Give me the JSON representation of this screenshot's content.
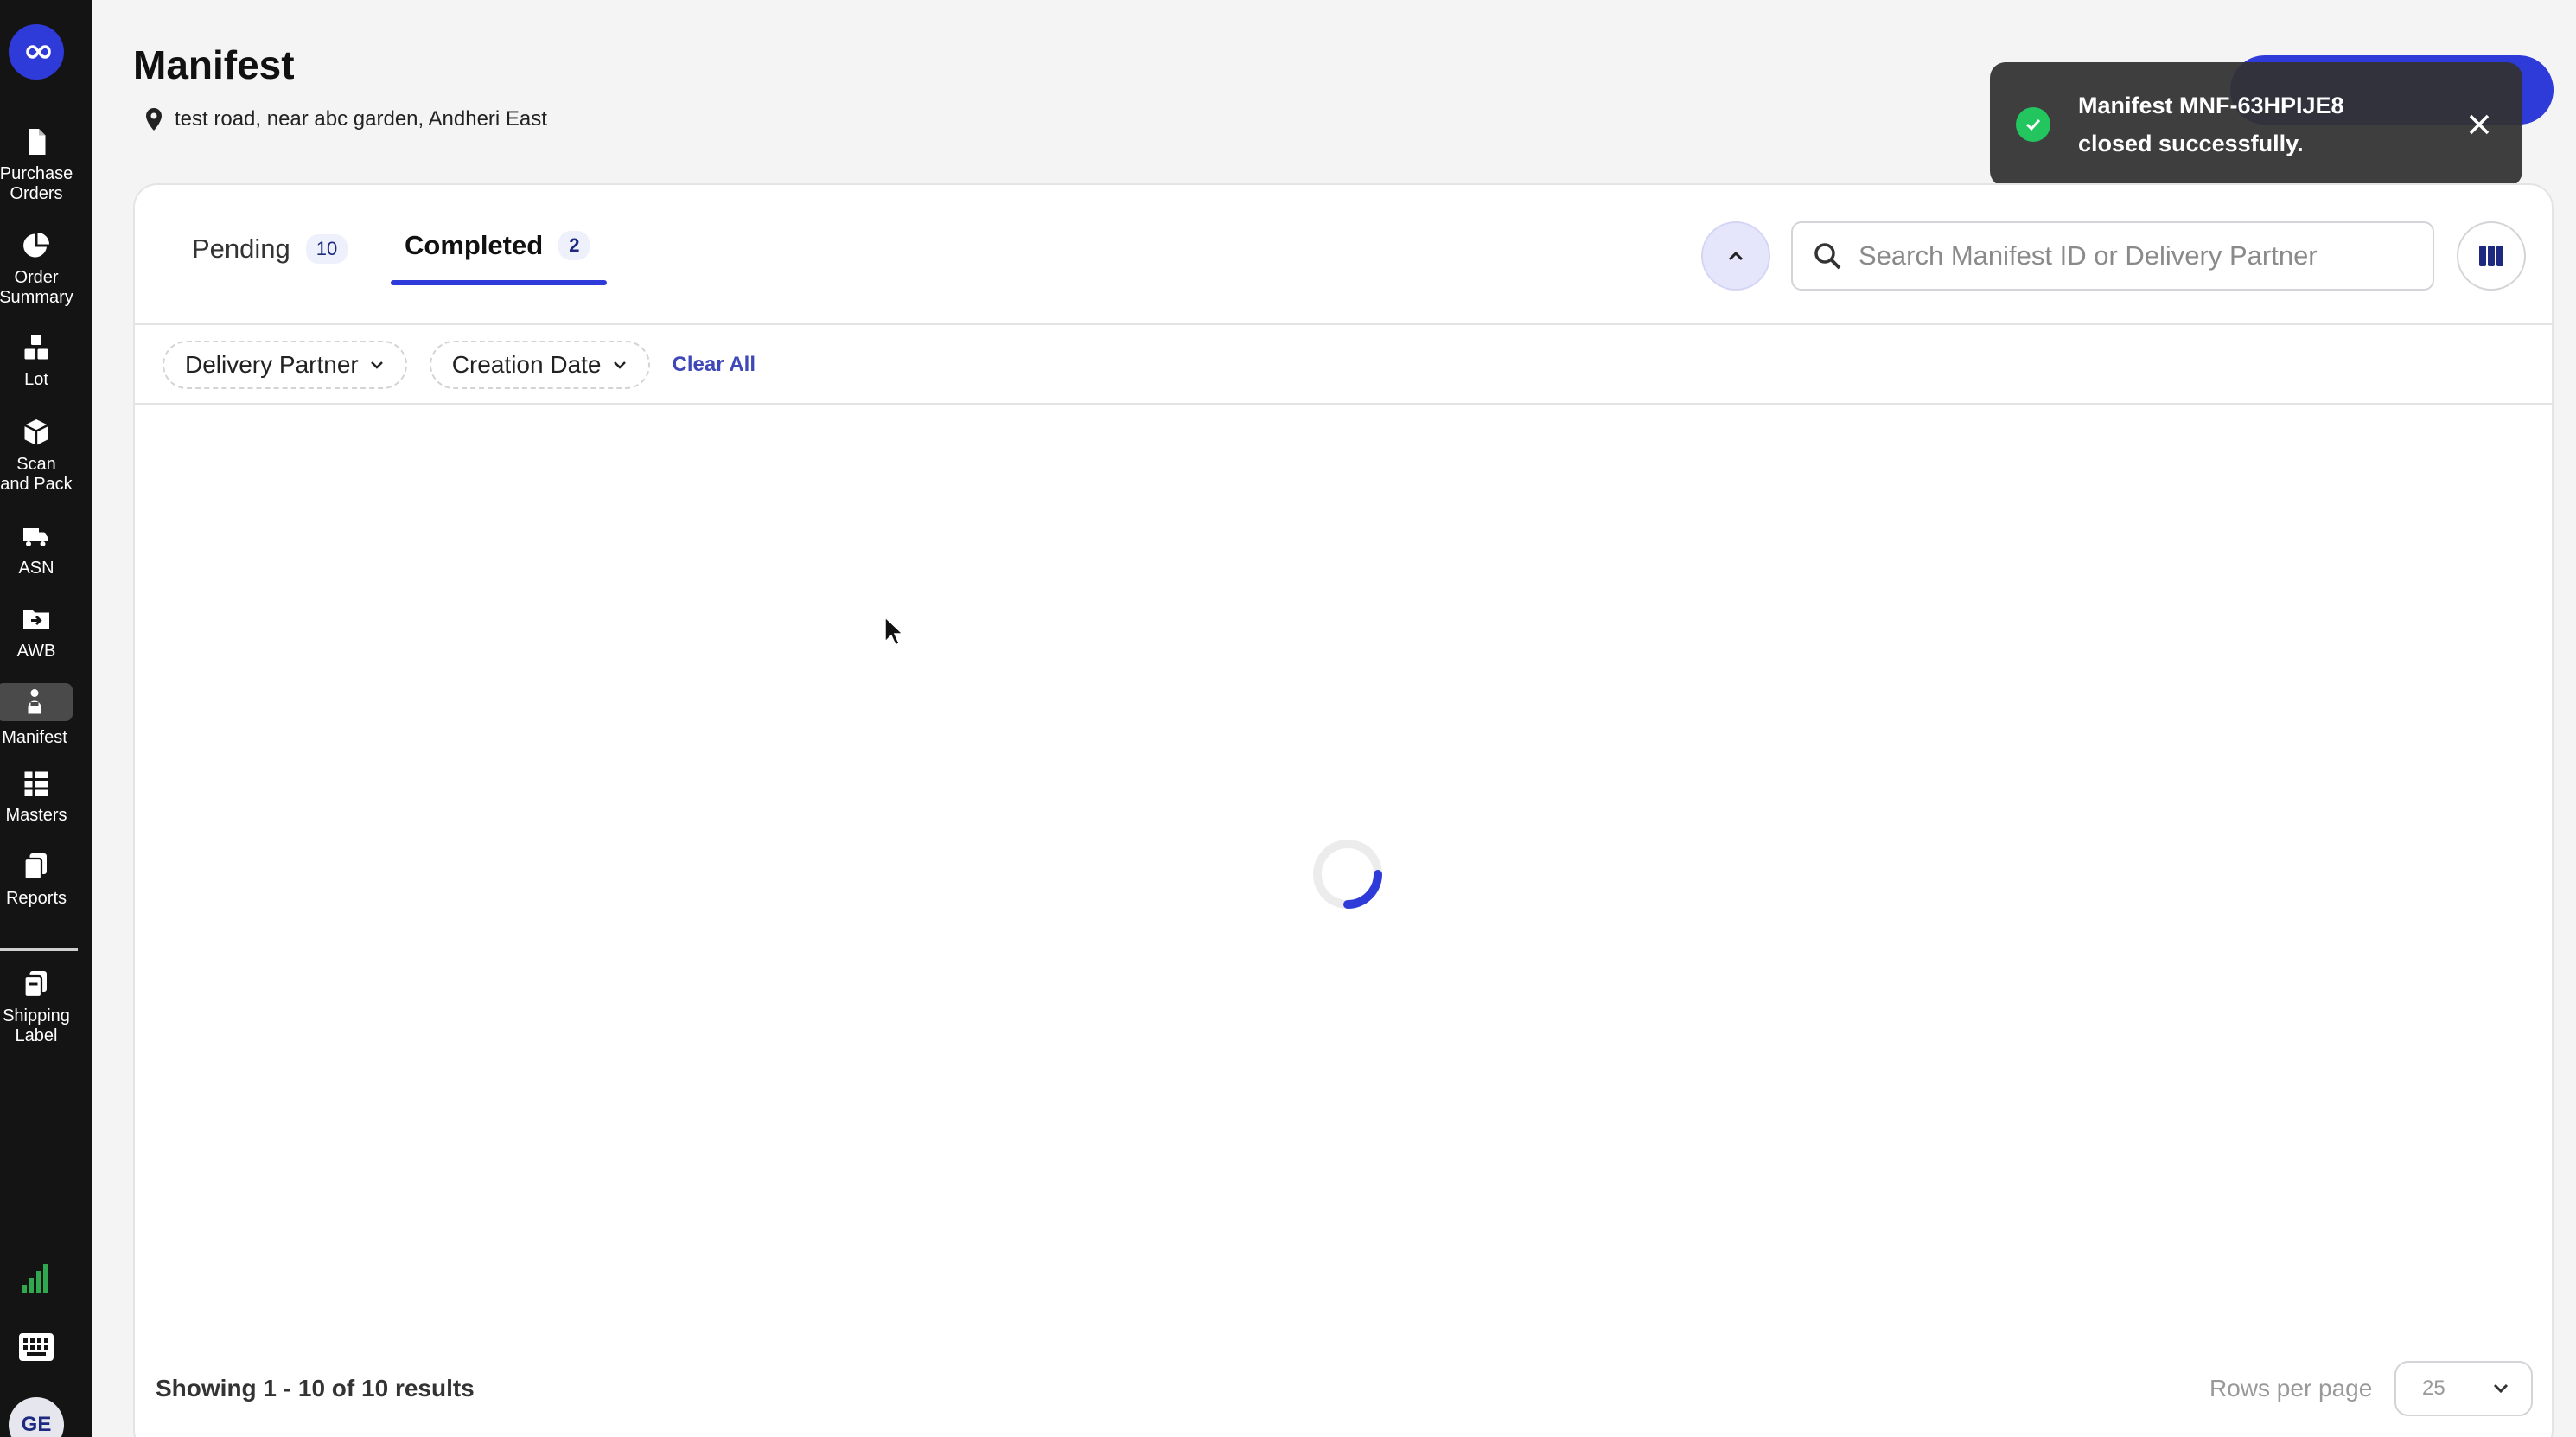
{
  "sidebar": {
    "items": [
      {
        "label": "Purchase Orders",
        "icon": "document-icon"
      },
      {
        "label": "Order Summary",
        "icon": "pie-chart-icon"
      },
      {
        "label": "Lot",
        "icon": "boxes-icon"
      },
      {
        "label": "Scan and Pack",
        "icon": "package-icon"
      },
      {
        "label": "ASN",
        "icon": "truck-icon"
      },
      {
        "label": "AWB",
        "icon": "folder-arrow-icon"
      },
      {
        "label": "Manifest",
        "icon": "person-dolly-icon"
      },
      {
        "label": "Masters",
        "icon": "list-icon"
      },
      {
        "label": "Reports",
        "icon": "reports-icon"
      },
      {
        "label": "Shipping Label",
        "icon": "label-icon"
      }
    ],
    "avatar": "GE",
    "active": "Manifest"
  },
  "header": {
    "title": "Manifest",
    "location": "test road, near abc garden, Andheri East"
  },
  "toast": {
    "message": "Manifest MNF-63HPIJE8 closed successfully.",
    "status_color": "#22c55e"
  },
  "tabs": [
    {
      "label": "Pending",
      "count": "10"
    },
    {
      "label": "Completed",
      "count": "2",
      "active": true
    }
  ],
  "search": {
    "placeholder": "Search Manifest ID or Delivery Partner",
    "value": ""
  },
  "filters": {
    "delivery_partner": "Delivery Partner",
    "creation_date": "Creation Date",
    "clear_all": "Clear All"
  },
  "footer": {
    "showing": "Showing 1 - 10 of 10 results",
    "rows_label": "Rows per page",
    "rows_value": "25"
  },
  "colors": {
    "accent": "#2f3bd8",
    "sidebar_bg": "#141414"
  }
}
